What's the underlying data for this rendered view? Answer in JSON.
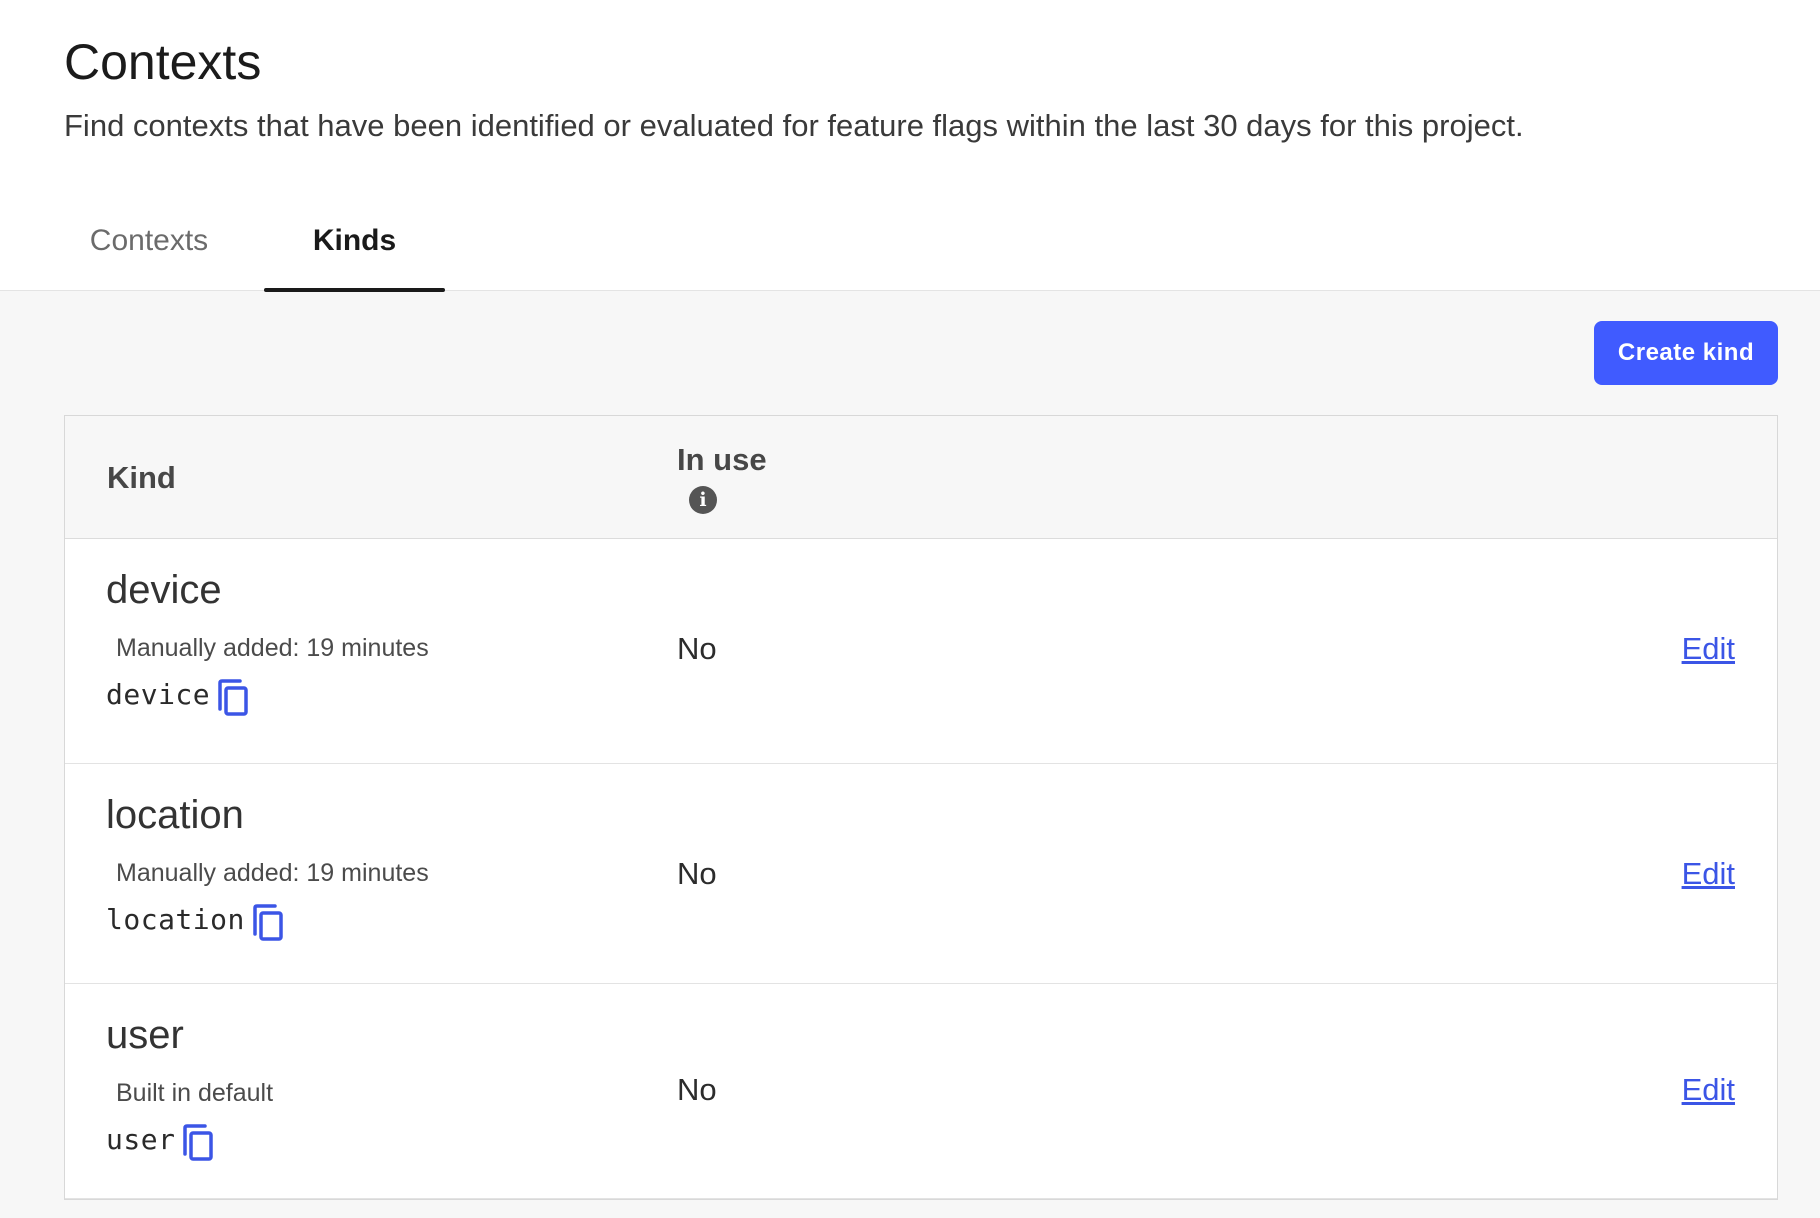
{
  "header": {
    "title": "Contexts",
    "description": "Find contexts that have been identified or evaluated for feature flags within the last 30 days for this project."
  },
  "tabs": [
    {
      "label": "Contexts",
      "active": false
    },
    {
      "label": "Kinds",
      "active": true
    }
  ],
  "toolbar": {
    "create_label": "Create kind"
  },
  "table": {
    "columns": {
      "kind": "Kind",
      "in_use": "In use"
    },
    "rows": [
      {
        "name": "device",
        "meta": "Manually added: 19 minutes",
        "key": "device",
        "in_use": "No",
        "action": "Edit"
      },
      {
        "name": "location",
        "meta": "Manually added: 19 minutes",
        "key": "location",
        "in_use": "No",
        "action": "Edit"
      },
      {
        "name": "user",
        "meta": "Built in default",
        "key": "user",
        "in_use": "No",
        "action": "Edit"
      }
    ]
  },
  "colors": {
    "accent": "#405bff",
    "link": "#3b55e6"
  }
}
